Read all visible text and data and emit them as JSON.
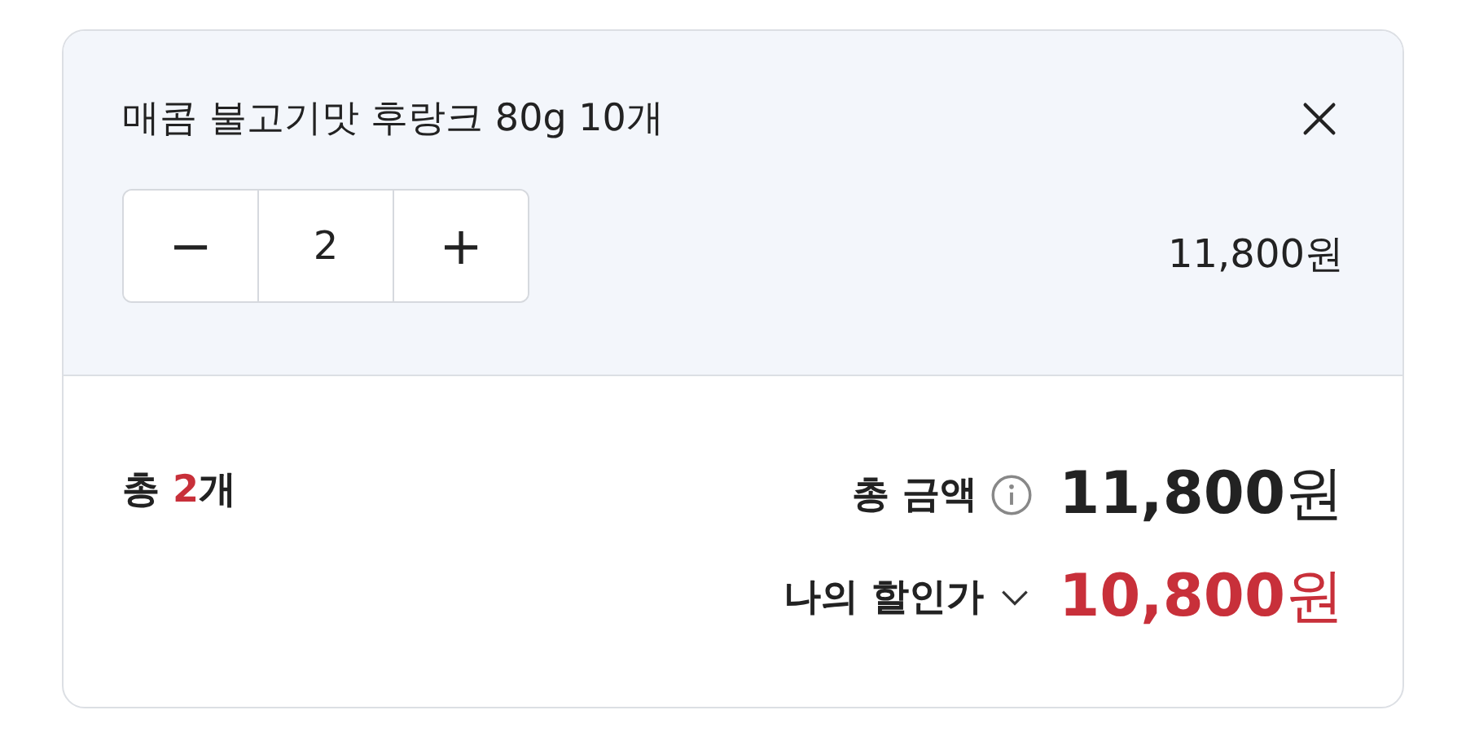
{
  "item": {
    "title": "매콤 불고기맛 후랑크 80g 10개",
    "stepper": {
      "minus": "−",
      "value": "2",
      "plus": "+"
    },
    "price": "11,800원"
  },
  "summary": {
    "count": {
      "prefix": "총 ",
      "number": "2",
      "suffix": "개"
    },
    "total": {
      "label": "총 금액",
      "amount": "**11,800**원"
    },
    "discount": {
      "label": "나의 할인가",
      "amount": "**10,800**원",
      "expanded": false
    }
  }
}
